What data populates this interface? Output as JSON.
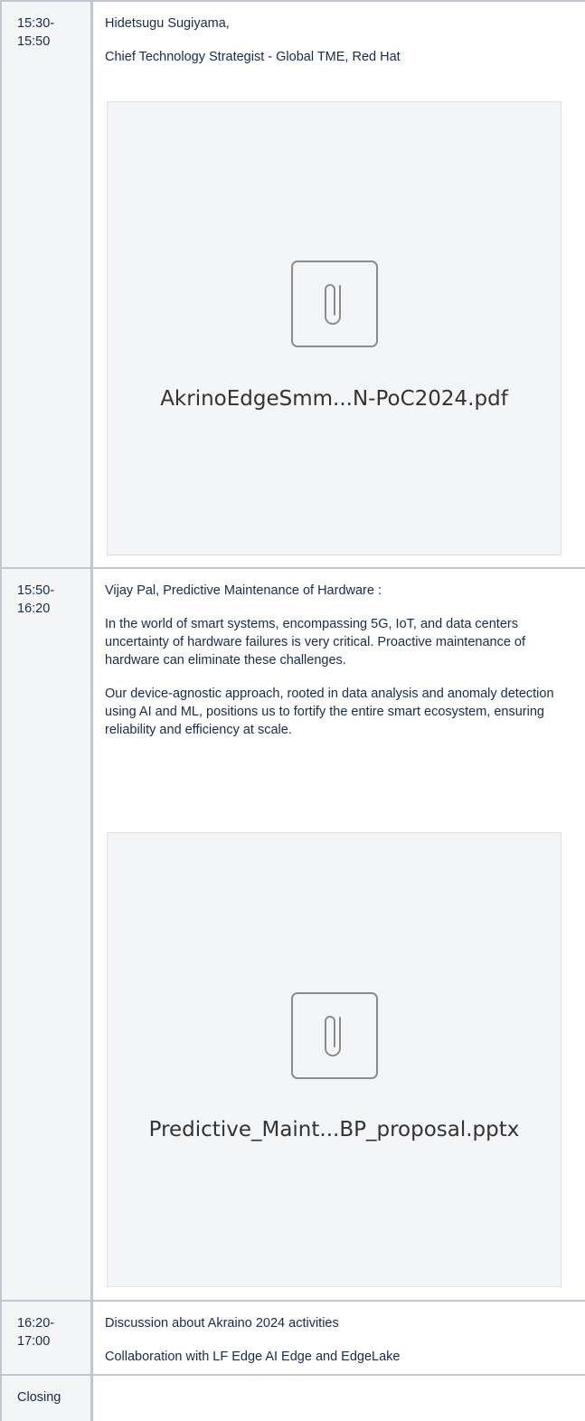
{
  "rows": [
    {
      "time": [
        "15:30-",
        "15:50"
      ],
      "paragraphs": [
        "Hidetsugu Sugiyama,",
        "Chief Technology Strategist - Global TME, Red Hat"
      ],
      "attachment": {
        "icon": "paperclip-icon",
        "file_name": "AkrinoEdgeSmm...N-PoC2024.pdf"
      }
    },
    {
      "time": [
        "15:50-",
        "16:20"
      ],
      "paragraphs": [
        "Vijay Pal, Predictive Maintenance of Hardware :",
        "In the world of smart systems, encompassing 5G, IoT, and data centers uncertainty of hardware failures is very critical. Proactive maintenance of hardware can eliminate these challenges.",
        "Our device-agnostic approach, rooted in data analysis and anomaly detection using AI and ML, positions us to fortify the entire smart ecosystem, ensuring reliability and efficiency at scale."
      ],
      "attachment": {
        "icon": "paperclip-icon",
        "file_name": "Predictive_Maint...BP_proposal.pptx"
      }
    },
    {
      "time": [
        "16:20-",
        "17:00"
      ],
      "paragraphs": [
        "Discussion about Akraino 2024 activities",
        "Collaboration with LF Edge AI Edge and EdgeLake"
      ]
    },
    {
      "time": [
        "Closing"
      ],
      "paragraphs": []
    }
  ],
  "colors": {
    "border": "#c1c7d0",
    "header_cell_bg": "#f4f5f7",
    "attachment_bg": "#f4f5f7",
    "text": "#172b4d",
    "icon": "#8c8c8c"
  }
}
